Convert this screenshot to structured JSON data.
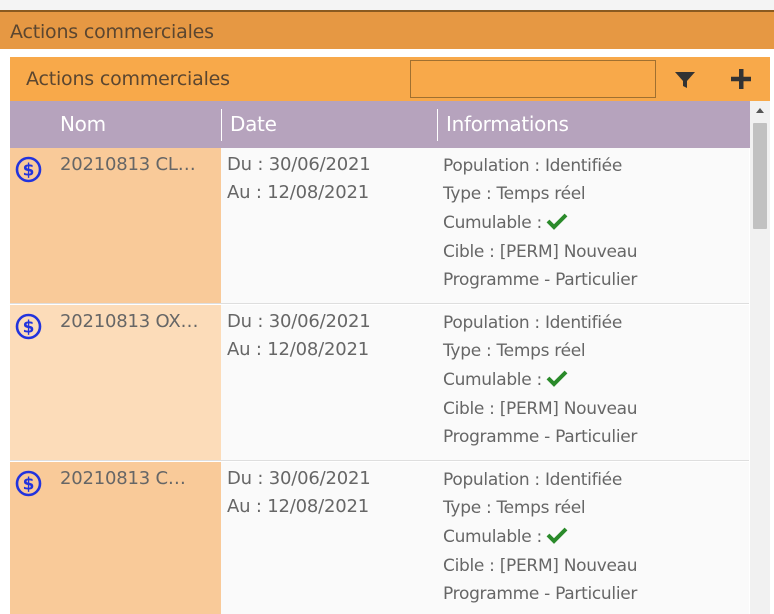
{
  "window": {
    "title": "Actions commerciales"
  },
  "panel": {
    "title": "Actions commerciales",
    "search": {
      "value": "",
      "placeholder": ""
    },
    "filter_icon": "filter-icon",
    "add_icon": "plus-icon"
  },
  "columns": {
    "nom": "Nom",
    "date": "Date",
    "informations": "Informations"
  },
  "rows": [
    {
      "nom": "20210813 CL…",
      "du": "Du : 30/06/2021",
      "au": "Au : 12/08/2021",
      "population": "Population : Identifiée",
      "type": "Type : Temps réel",
      "cumulable": "Cumulable :",
      "cible1": "Cible : [PERM] Nouveau",
      "cible2": "Programme - Particulier",
      "nom_bg": "#f9ca99"
    },
    {
      "nom": "20210813 OX…",
      "du": "Du : 30/06/2021",
      "au": "Au : 12/08/2021",
      "population": "Population : Identifiée",
      "type": "Type : Temps réel",
      "cumulable": "Cumulable :",
      "cible1": "Cible : [PERM] Nouveau",
      "cible2": "Programme - Particulier",
      "nom_bg": "#fcdcb9"
    },
    {
      "nom": "20210813 C…",
      "du": "Du : 30/06/2021",
      "au": "Au : 12/08/2021",
      "population": "Population : Identifiée",
      "type": "Type : Temps réel",
      "cumulable": "Cumulable :",
      "cible1": "Cible : [PERM] Nouveau",
      "cible2": "Programme - Particulier",
      "nom_bg": "#f9ca99"
    }
  ],
  "colors": {
    "outer_header": "#e69843",
    "panel_header": "#f8a94a",
    "grid_header": "#b6a3bd",
    "dollar_icon": "#2233dd",
    "check_icon": "#2a8a2a"
  }
}
